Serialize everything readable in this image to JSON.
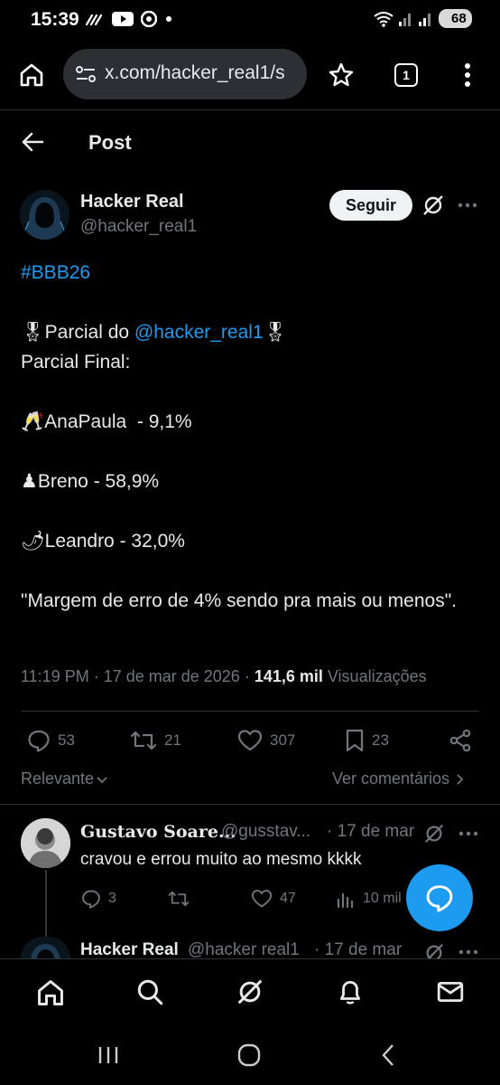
{
  "status_bar": {
    "time": "15:39",
    "battery": "68"
  },
  "browser": {
    "url": "x.com/hacker_real1/s",
    "tab_count": "1"
  },
  "header": {
    "title": "Post"
  },
  "post": {
    "author_name": "Hacker Real",
    "author_handle": "@hacker_real1",
    "follow_label": "Seguir",
    "hashtag": "#BBB26",
    "line_partial_prefix": "Parcial do ",
    "mention": "@hacker_real1",
    "line_final": "Parcial Final:",
    "candidate_1": "AnaPaula  - 9,1%",
    "candidate_2": "Breno - 58,9%",
    "candidate_3": "Leandro - 32,0%",
    "closing": "\"Margem de erro de 4% sendo pra mais ou menos\".",
    "time": "11:19 PM · 17 de mar de 2026 · ",
    "views_count": "141,6 mil",
    "views_label": " Visualizações",
    "replies": "53",
    "reposts": "21",
    "likes": "307",
    "bookmarks": "23"
  },
  "replies_bar": {
    "sort_label": "Relevante",
    "see_comments": "Ver comentários"
  },
  "reply": {
    "name": "Gustavo Soare...",
    "handle": "@gusstav...",
    "date": "· 17 de mar",
    "text": "cravou e errou muito ao mesmo kkkk",
    "replies": "3",
    "likes": "47",
    "views": "10 mil"
  },
  "reply_2": {
    "name": "Hacker Real",
    "handle": "@hacker real1",
    "date": "· 17 de mar"
  },
  "colors": {
    "accent": "#1d9bf0",
    "text": "#e7e9ea",
    "muted": "#71767b",
    "background": "#000000"
  }
}
